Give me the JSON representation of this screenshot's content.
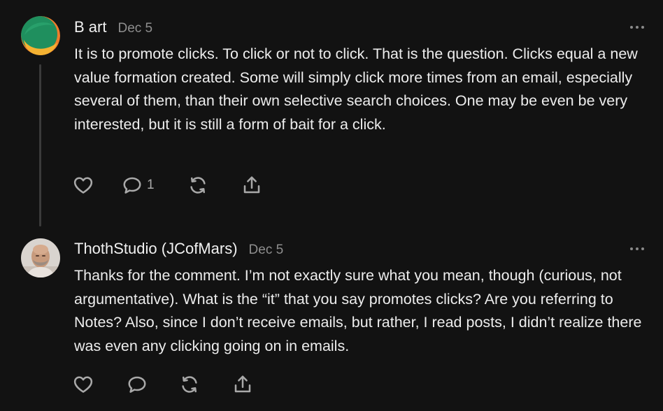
{
  "comments": [
    {
      "author": "B art",
      "date": "Dec 5",
      "avatar": "green-orange-circle-logo",
      "text": "It is to promote clicks. To click or not to click. That is the question. Clicks equal a new value formation created. Some will simply click more times from an email, especially several of them, than their own selective search choices. One may be even be very interested, but it is still a form of bait for a click.",
      "reply_count": "1",
      "icons": [
        "heart-icon",
        "comment-icon",
        "restack-icon",
        "share-icon",
        "more-icon"
      ]
    },
    {
      "author": "ThothStudio (JCofMars)",
      "date": "Dec 5",
      "avatar": "bald-man-photo",
      "text": "Thanks for the comment. I’m not exactly sure what you mean, though (curious, not argumentative). What is the “it” that you say promotes clicks? Are you referring to Notes? Also, since I don’t receive emails, but rather, I read posts, I didn’t realize there was even any clicking going on in emails.",
      "icons": [
        "heart-icon",
        "comment-icon",
        "restack-icon",
        "share-icon",
        "more-icon"
      ]
    }
  ],
  "colors": {
    "background": "#121212",
    "text": "#ededed",
    "muted": "#8e8e8e",
    "icon": "#a9a9a9",
    "thread_line": "#3a3a3a"
  }
}
